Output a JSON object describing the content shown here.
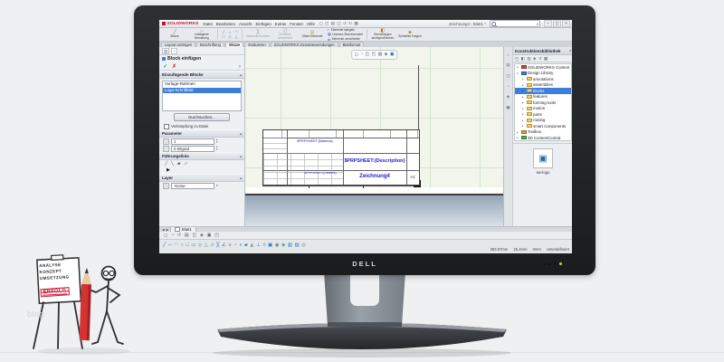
{
  "colors": {
    "sw_red": "#c8102e",
    "annotation_blue": "#2222c8",
    "selection_blue": "#3d7edb",
    "erfolg_red": "#c8102e",
    "grid_green": "#d2e6cd"
  },
  "icons": {
    "caret_up": "▴",
    "caret_down": "▾",
    "pm_tab1": "▤",
    "pm_tab2": "◔",
    "block_glyph": "▣"
  },
  "monitor": {
    "brand": "DELL"
  },
  "watermark": "blog",
  "flipchart": {
    "lines": [
      {
        "text": "ANALYSE"
      },
      {
        "text": "KONZEPT"
      },
      {
        "text": "UMSETZUNG"
      },
      {
        "text": "ERFOLG",
        "cls": "red"
      }
    ]
  },
  "app": {
    "logo": "SOLIDWORKS",
    "menus": [
      "Datei",
      "Bearbeiten",
      "Ansicht",
      "Einfügen",
      "Extras",
      "Fenster",
      "Hilfe"
    ],
    "quick_icons": [
      "◻",
      "◰",
      "▤",
      "◫",
      "↺",
      "↻",
      "▦"
    ],
    "window_title": "Zeichnung4 - Blatt1 *",
    "window_controls": [
      "–",
      "◻",
      "×"
    ],
    "ribbon": {
      "buttons_left": [
        {
          "g": "╱",
          "label": "Skizze"
        },
        {
          "g": "↔",
          "label": "Intelligente Bemaßung"
        }
      ],
      "grid_icons": [
        "╱",
        "○",
        "◠",
        "□",
        "◇",
        "△"
      ],
      "buttons_mid": [
        {
          "g": "╳",
          "label": "Elemente trimmen",
          "cls": "dis"
        },
        {
          "g": "◫",
          "label": "Elemente umwandeln",
          "cls": "dis"
        },
        {
          "g": "◎",
          "label": "Offset Elemente"
        }
      ],
      "buttons_stack": [
        {
          "g": "◐",
          "label": "Elemente spiegeln"
        },
        {
          "g": "▦",
          "label": "Lineares Skizzenmuster"
        },
        {
          "g": "⇄",
          "label": "Elemente verschieben"
        }
      ],
      "buttons_right": [
        {
          "g": "◧",
          "label": "Bemaßungen anzeigen/löschen"
        },
        {
          "g": "◈",
          "label": "Schnelles Fangen"
        }
      ]
    },
    "tabs": [
      {
        "label": "Layout anzeigen"
      },
      {
        "label": "Beschriftung"
      },
      {
        "label": "Skizze",
        "cls": "active"
      },
      {
        "label": "Evaluieren"
      },
      {
        "label": "SOLIDWORKS Zusatzanwendungen"
      },
      {
        "label": "Blattformat"
      }
    ],
    "property_manager": {
      "title": "Block einfügen",
      "ok_icon": "✓",
      "cancel_icon": "✗",
      "help_icon": "?",
      "blocks": {
        "header": "Einzufügende Blöcke",
        "items": [
          {
            "label": "Vorlage-Rahmen"
          },
          {
            "label": "Logo-Schriftfeld",
            "cls": "sel"
          }
        ],
        "browse_button": "Durchsuchen...",
        "link_checkbox": "Verknüpfung zu Datei"
      },
      "parameter": {
        "header": "Parameter",
        "scale": "1",
        "angle": "0.00grad"
      },
      "leader": {
        "header": "Führungslinie",
        "icons": [
          "╱",
          "╲",
          "▰",
          "▱"
        ],
        "arrow": "▶"
      },
      "layer": {
        "header": "Layer",
        "value": "-Keine-"
      }
    },
    "graphics": {
      "hud_icons": [
        "◻",
        "◔",
        "◫",
        "◰",
        "▤",
        "◈",
        "▣"
      ],
      "title_block": {
        "material": "$PRPSHEET:{Material}",
        "description": "$PRPSHEET:{Description}",
        "weight": "$PRPSHEET:{Gewicht}",
        "name": "Zeichnung4",
        "format": "A2"
      }
    },
    "task_pane": {
      "title": "Konstruktionsbibliothek",
      "pin_icon": "▾",
      "tab_icons": [
        "⌂",
        "▤",
        "◫",
        "◔",
        "◈",
        "▣"
      ],
      "tool_icons": [
        "◰",
        "◧",
        "▥",
        "◈",
        "↺",
        "▦"
      ],
      "tree": [
        {
          "t": "▸",
          "label": "SOLIDWORKS Content",
          "cls": "d0 ic-red"
        },
        {
          "t": "▾",
          "label": "Design Library",
          "cls": "d0 ic-blue"
        },
        {
          "t": "▸",
          "label": "annotations",
          "cls": "d1"
        },
        {
          "t": "▸",
          "label": "assemblies",
          "cls": "d1"
        },
        {
          "t": "▸",
          "label": "blocks",
          "cls": "d1 sel"
        },
        {
          "t": "▸",
          "label": "features",
          "cls": "d1"
        },
        {
          "t": "▸",
          "label": "forming tools",
          "cls": "d1"
        },
        {
          "t": "▸",
          "label": "motion",
          "cls": "d1"
        },
        {
          "t": "▸",
          "label": "parts",
          "cls": "d1"
        },
        {
          "t": "▸",
          "label": "routing",
          "cls": "d1"
        },
        {
          "t": "▸",
          "label": "smart components",
          "cls": "d1"
        },
        {
          "t": "▸",
          "label": "Toolbox",
          "cls": "d0 ic-orange"
        },
        {
          "t": "▸",
          "label": "3D ContentCentral",
          "cls": "d0 ic-green"
        }
      ],
      "preview_label": "sw-logo"
    },
    "sheet_nav": {
      "prev": "◀",
      "next": "▶",
      "tab": "Blatt1"
    },
    "view_toolbar_icons": [
      "◻",
      "◔",
      "↺",
      "▤",
      "◫",
      "◈",
      "▣",
      "◰"
    ],
    "sketch_toolbar_icons": [
      "╱",
      "─",
      "◠",
      "○",
      "□",
      "▭",
      "◇",
      "△",
      "▱",
      "╳",
      "∠",
      "≡",
      "◔",
      "◑",
      "▰",
      "◭",
      "⊥",
      "±",
      "▣",
      "◉",
      "◈",
      "▥",
      "▨",
      "◎"
    ],
    "status": {
      "coords": [
        "383.87mm",
        "25.4mm",
        "0mm"
      ],
      "state": "Unterdefiniert"
    }
  }
}
